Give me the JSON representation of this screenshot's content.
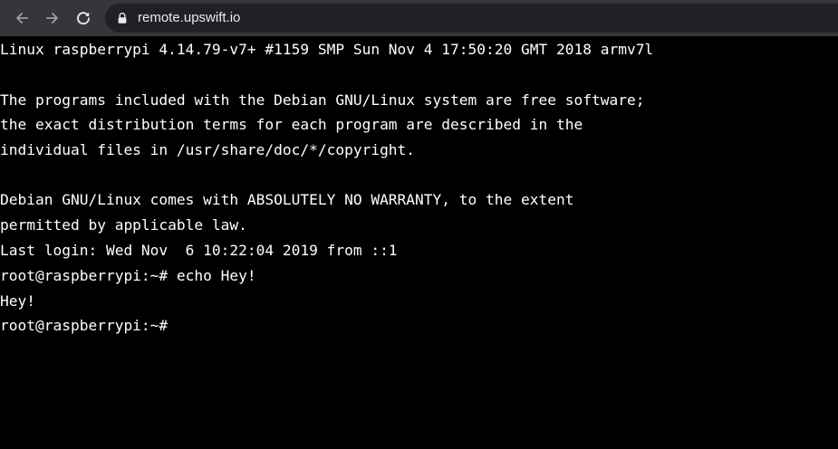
{
  "browser": {
    "url": "remote.upswift.io",
    "icons": {
      "back": "arrow-left-icon",
      "forward": "arrow-right-icon",
      "reload": "reload-icon",
      "lock": "lock-icon"
    },
    "colors": {
      "toolbar": "#35363a",
      "omnibox": "#202124",
      "icon": "#9aa0a6",
      "url_text": "#e8eaed"
    }
  },
  "terminal": {
    "colors": {
      "background": "#000000",
      "text": "#ffffff"
    },
    "lines": [
      "Linux raspberrypi 4.14.79-v7+ #1159 SMP Sun Nov 4 17:50:20 GMT 2018 armv7l",
      "",
      "The programs included with the Debian GNU/Linux system are free software;",
      "the exact distribution terms for each program are described in the",
      "individual files in /usr/share/doc/*/copyright.",
      "",
      "Debian GNU/Linux comes with ABSOLUTELY NO WARRANTY, to the extent",
      "permitted by applicable law.",
      "Last login: Wed Nov  6 10:22:04 2019 from ::1",
      "root@raspberrypi:~# echo Hey!",
      "Hey!",
      "root@raspberrypi:~#"
    ]
  }
}
